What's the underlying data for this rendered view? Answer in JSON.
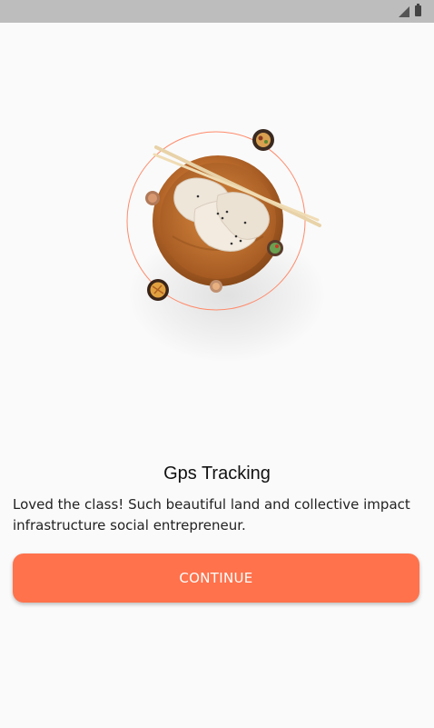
{
  "status_bar": {
    "icons": [
      "signal-icon",
      "battery-icon"
    ]
  },
  "hero": {
    "image": "dumpling-bowl-illustration",
    "accent_color": "#ff724c"
  },
  "onboarding": {
    "title": "Gps Tracking",
    "description": "Loved the class! Such beautiful land and collective impact infrastructure social entrepreneur.",
    "continue_label": "CONTINUE"
  },
  "colors": {
    "primary": "#ff724c",
    "background": "#fafafa",
    "status_bar": "#bdbdbd"
  }
}
